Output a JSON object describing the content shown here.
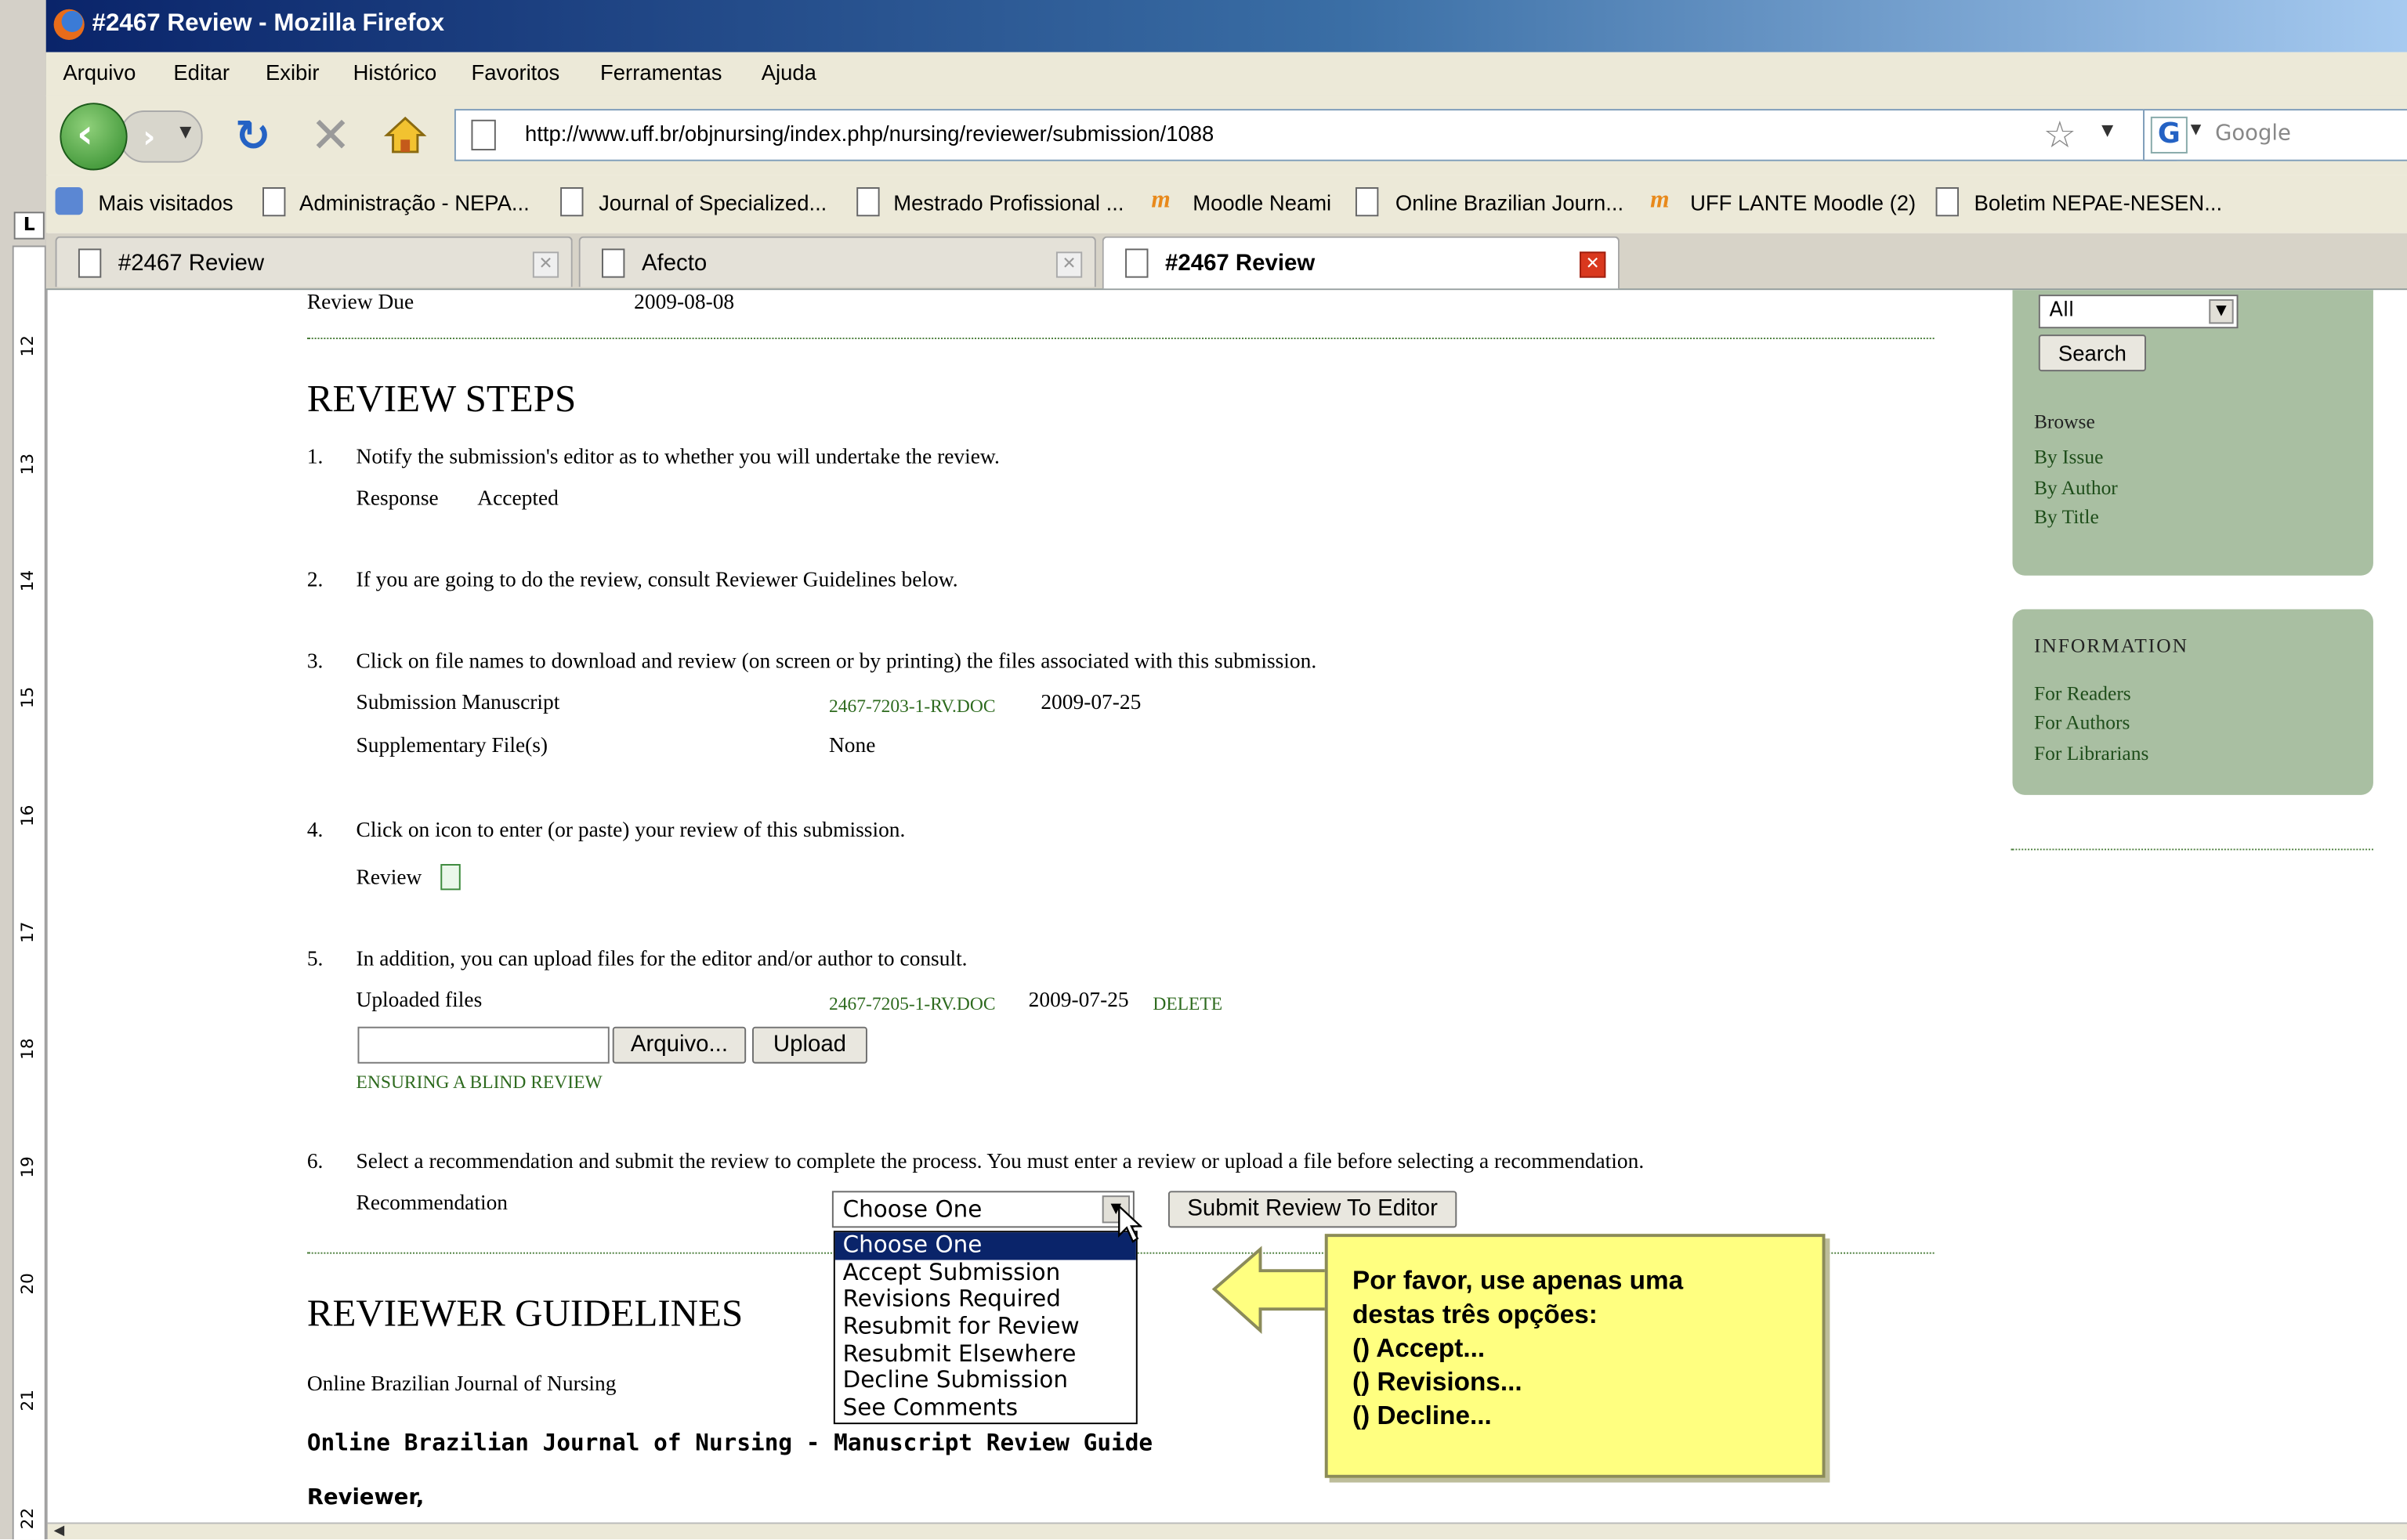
{
  "window": {
    "title": "#2467 Review - Mozilla Firefox"
  },
  "menu": [
    "Arquivo",
    "Editar",
    "Exibir",
    "Histórico",
    "Favoritos",
    "Ferramentas",
    "Ajuda"
  ],
  "address": {
    "url": "http://www.uff.br/objnursing/index.php/nursing/reviewer/submission/1088"
  },
  "search": {
    "placeholder": "Google"
  },
  "bookmarks": [
    "Mais visitados",
    "Administração - NEPA...",
    "Journal of Specialized...",
    "Mestrado Profissional ...",
    "Moodle Neami",
    "Online Brazilian Journ...",
    "UFF LANTE Moodle (2)",
    "Boletim NEPAE-NESEN..."
  ],
  "tabs": [
    {
      "label": "#2467 Review",
      "active": false
    },
    {
      "label": "Afecto",
      "active": false
    },
    {
      "label": "#2467 Review",
      "active": true
    }
  ],
  "ruler_numbers": [
    "12",
    "13",
    "14",
    "15",
    "16",
    "17",
    "18",
    "19",
    "20",
    "21",
    "22"
  ],
  "page": {
    "review_due_label": "Review Due",
    "review_due_value": "2009-08-08",
    "steps_heading": "REVIEW STEPS",
    "step1": {
      "num": "1.",
      "text": "Notify the submission's editor as to whether you will undertake the review.",
      "response_label": "Response",
      "response_value": "Accepted"
    },
    "step2": {
      "num": "2.",
      "text": "If you are going to do the review, consult Reviewer Guidelines below."
    },
    "step3": {
      "num": "3.",
      "text": "Click on file names to download and review (on screen or by printing) the files associated with this submission.",
      "manuscript_label": "Submission Manuscript",
      "manuscript_file": "2467-7203-1-RV.DOC",
      "manuscript_date": "2009-07-25",
      "supp_label": "Supplementary File(s)",
      "supp_value": "None"
    },
    "step4": {
      "num": "4.",
      "text": "Click on icon to enter (or paste) your review of this submission.",
      "review_label": "Review"
    },
    "step5": {
      "num": "5.",
      "text": "In addition, you can upload files for the editor and/or author to consult.",
      "uploaded_label": "Uploaded files",
      "uploaded_file": "2467-7205-1-RV.DOC",
      "uploaded_date": "2009-07-25",
      "delete_label": "DELETE",
      "browse_button": "Arquivo...",
      "upload_button": "Upload",
      "blind_link": "ENSURING A BLIND REVIEW"
    },
    "step6": {
      "num": "6.",
      "text": "Select a recommendation and submit the review to complete the process. You must enter a review or upload a file before selecting a recommendation.",
      "recommendation_label": "Recommendation",
      "selected": "Choose One",
      "submit_button": "Submit Review To Editor",
      "options": [
        "Choose One",
        "Accept Submission",
        "Revisions Required",
        "Resubmit for Review",
        "Resubmit Elsewhere",
        "Decline Submission",
        "See Comments"
      ]
    },
    "guidelines_heading": "REVIEWER GUIDELINES",
    "guidelines_journal": "Online Brazilian Journal of Nursing",
    "guidelines_title": "Online Brazilian Journal of Nursing - Manuscript Review Guide",
    "guidelines_reviewer": "Reviewer,"
  },
  "sidebar": {
    "scope_value": "All",
    "search_button": "Search",
    "browse_heading": "Browse",
    "browse_links": [
      "By Issue",
      "By Author",
      "By Title"
    ],
    "info_heading": "INFORMATION",
    "info_links": [
      "For Readers",
      "For Authors",
      "For Librarians"
    ]
  },
  "callout": {
    "text": "Por favor, use apenas uma\ndestas três opções:\n() Accept...\n() Revisions...\n() Decline..."
  },
  "colors": {
    "link_green": "#2d6a1e",
    "sidebar_box": "#a9bfa2",
    "callout_yellow": "#ffff80",
    "title_blue": "#0a246a"
  }
}
